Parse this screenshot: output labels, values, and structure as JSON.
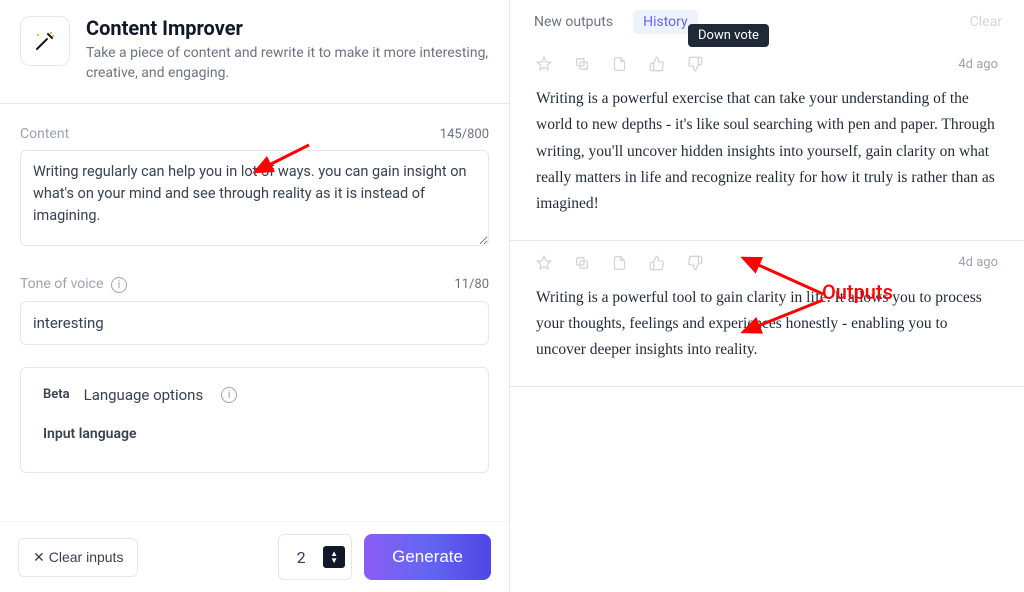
{
  "header": {
    "title": "Content Improver",
    "description": "Take a piece of content and rewrite it to make it more interesting, creative, and engaging."
  },
  "content": {
    "label": "Content",
    "counter": "145/800",
    "value": "Writing regularly can help you in lot of ways. you can gain insight on what's on your mind and see through reality as it is instead of imagining."
  },
  "tone": {
    "label": "Tone of voice",
    "counter": "11/80",
    "value": "interesting"
  },
  "lang": {
    "beta": "Beta",
    "options": "Language options",
    "input_label": "Input language"
  },
  "footer": {
    "clear": "Clear inputs",
    "count": "2",
    "generate": "Generate"
  },
  "tabs": {
    "new": "New outputs",
    "history": "History",
    "clear": "Clear"
  },
  "tooltip": "Down vote",
  "outputs": [
    {
      "time": "4d ago",
      "text": "Writing is a powerful exercise that can take your understanding of the world to new depths - it's like soul searching with pen and paper. Through writing, you'll uncover hidden insights into yourself, gain clarity on what really matters in life and recognize reality for how it truly is rather than as imagined!"
    },
    {
      "time": "4d ago",
      "text": "Writing is a powerful tool to gain clarity in life. It allows you to process your thoughts, feelings and experiences honestly - enabling you to uncover deeper insights into reality."
    }
  ],
  "annotation": {
    "label": "Outputs"
  }
}
